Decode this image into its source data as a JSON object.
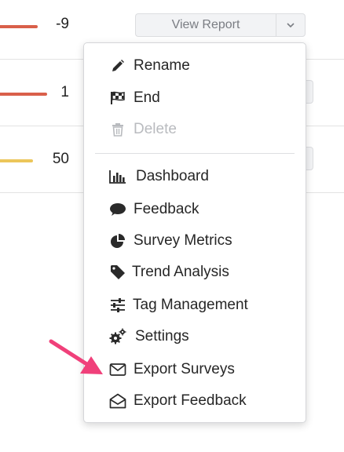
{
  "rows": [
    {
      "score": "-9",
      "bar_color": "#d95f4a"
    },
    {
      "score": "1",
      "bar_color": "#d95f4a"
    },
    {
      "score": "50",
      "bar_color": "#ecc65a"
    }
  ],
  "view_report": {
    "label": "View Report"
  },
  "menu": {
    "items": [
      {
        "label": "Rename",
        "icon": "pencil-icon",
        "disabled": false
      },
      {
        "label": "End",
        "icon": "checkered-flag-icon",
        "disabled": false
      },
      {
        "label": "Delete",
        "icon": "trash-icon",
        "disabled": true
      },
      {
        "label": "Dashboard",
        "icon": "bar-chart-icon",
        "disabled": false
      },
      {
        "label": "Feedback",
        "icon": "speech-bubble-icon",
        "disabled": false
      },
      {
        "label": "Survey Metrics",
        "icon": "pie-chart-icon",
        "disabled": false
      },
      {
        "label": "Trend Analysis",
        "icon": "tag-icon",
        "disabled": false
      },
      {
        "label": "Tag Management",
        "icon": "sliders-icon",
        "disabled": false
      },
      {
        "label": "Settings",
        "icon": "gears-icon",
        "disabled": false
      },
      {
        "label": "Export Surveys",
        "icon": "envelope-closed-icon",
        "disabled": false
      },
      {
        "label": "Export Feedback",
        "icon": "envelope-open-icon",
        "disabled": false
      }
    ]
  },
  "colors": {
    "arrow": "#f0407a",
    "negative_bar": "#d95f4a",
    "positive_bar": "#ecc65a"
  }
}
